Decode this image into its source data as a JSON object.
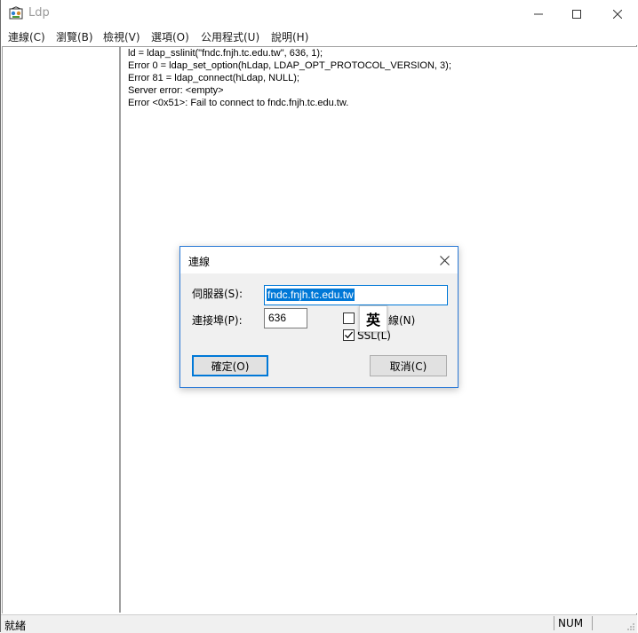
{
  "window": {
    "title": "Ldp",
    "minimize_glyph": "─",
    "maximize_glyph": "☐",
    "close_glyph": "✕"
  },
  "menu": {
    "items": [
      {
        "label": "連線(C)"
      },
      {
        "label": "瀏覽(B)"
      },
      {
        "label": "檢視(V)"
      },
      {
        "label": "選項(O)"
      },
      {
        "label": "公用程式(U)"
      },
      {
        "label": "說明(H)"
      }
    ]
  },
  "log": {
    "lines": [
      "ld = ldap_sslinit(\"fndc.fnjh.tc.edu.tw\", 636, 1);",
      "Error 0 = ldap_set_option(hLdap, LDAP_OPT_PROTOCOL_VERSION, 3);",
      "Error 81 = ldap_connect(hLdap, NULL);",
      "Server error: <empty>",
      "Error <0x51>: Fail to connect to fndc.fnjh.tc.edu.tw."
    ]
  },
  "status": {
    "text": "就緒",
    "num": "NUM"
  },
  "dialog": {
    "title": "連線",
    "close_glyph": "✕",
    "server_label": "伺服器(S):",
    "server_value": "fndc.fnjh.tc.edu.tw",
    "port_label": "連接埠(P):",
    "port_value": "636",
    "connectionless_label_partial": "線(N)",
    "ssl_label": "SSL(L)",
    "connectionless_checked": false,
    "ssl_checked": true,
    "ok_label": "確定(O)",
    "cancel_label": "取消(C)"
  },
  "ime": {
    "indicator": "英"
  },
  "colors": {
    "accent": "#0078d7",
    "dialog_border": "#2b79d6"
  }
}
